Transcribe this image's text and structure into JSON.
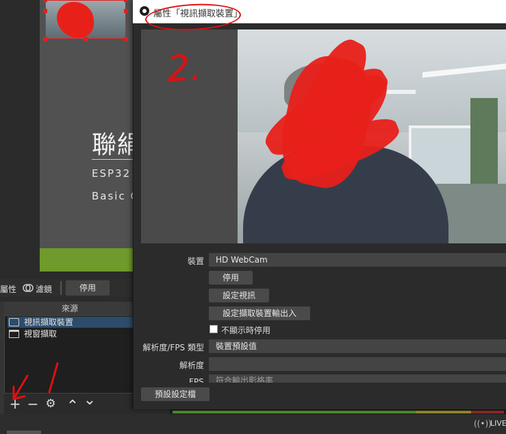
{
  "preview": {
    "slide_title": "聯絹",
    "slide_sub1": "ESP32",
    "slide_sub2": "Basic C"
  },
  "source_toolbar": {
    "properties_label": "屬性",
    "filters_label": "濾鏡",
    "disable_label": "停用"
  },
  "sources_dock": {
    "header": "來源",
    "items": [
      {
        "label": "視訊擷取裝置",
        "icon": "camera-icon",
        "selected": true
      },
      {
        "label": "視窗擷取",
        "icon": "window-icon",
        "selected": false
      }
    ],
    "controls": {
      "add": "+",
      "remove": "−",
      "settings": "⚙",
      "up": "⌃",
      "down": "⌄"
    }
  },
  "status": {
    "live": "LIVE",
    "live_icon": "((•))"
  },
  "dialog": {
    "title": "屬性「視訊擷取裝置」",
    "device_label": "裝置",
    "device_value": "HD WebCam",
    "disable_button": "停用",
    "configure_video_button": "設定視訊",
    "configure_crossbar_button": "設定擷取裝置輸出入",
    "deactivate_checkbox_label": "不顯示時停用",
    "deactivate_checked": false,
    "res_type_label": "解析度/FPS 類型",
    "res_type_value": "裝置預設值",
    "resolution_label": "解析度",
    "resolution_value": "",
    "fps_label": "FPS",
    "fps_value": "符合輸出影格率",
    "defaults_button": "預設設定檔"
  },
  "annotations": {
    "step_two": "2.",
    "color": "#e01010"
  },
  "colors": {
    "accent_selection": "#2d4c6b",
    "slide_green": "#6f9a2c",
    "marker_red": "#e8201a"
  }
}
